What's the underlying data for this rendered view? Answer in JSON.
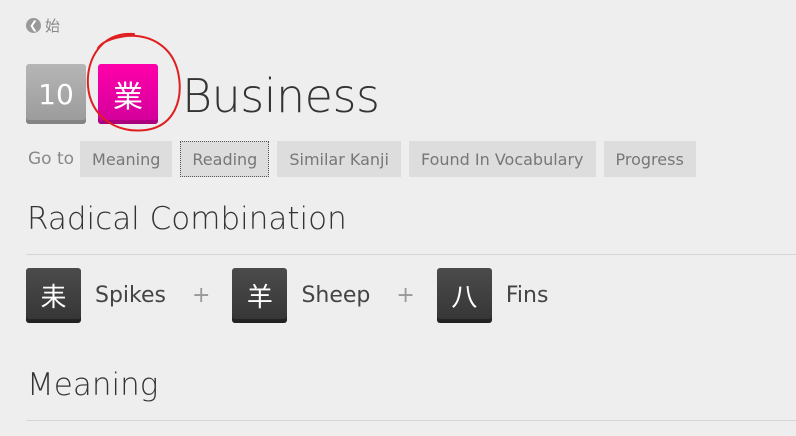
{
  "breadcrumb": {
    "icon": "arrow-left-circle-icon",
    "label": "始"
  },
  "header": {
    "level": "10",
    "kanji": "業",
    "meaning": "Business",
    "kanji_color": "#f100a1",
    "level_color": "#a8a8a8"
  },
  "goto": {
    "label": "Go to",
    "buttons": [
      "Meaning",
      "Reading",
      "Similar Kanji",
      "Found In Vocabulary",
      "Progress"
    ]
  },
  "sections": {
    "radical_combination": "Radical Combination",
    "meaning": "Meaning"
  },
  "radicals": [
    {
      "symbol": "⽾",
      "name": "Spikes"
    },
    {
      "symbol": "羊",
      "name": "Sheep"
    },
    {
      "symbol": "八",
      "name": "Fins"
    }
  ],
  "plus_sign": "+"
}
